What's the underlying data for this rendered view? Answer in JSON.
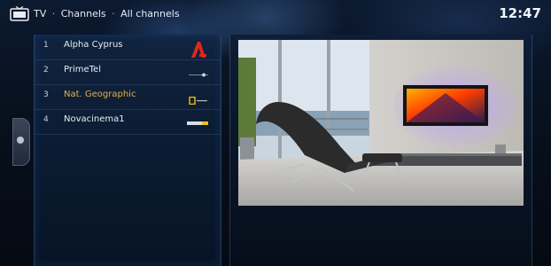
{
  "header": {
    "section": "TV",
    "separator": "·",
    "page": "Channels",
    "filter": "All channels",
    "time": "12:47"
  },
  "channels": [
    {
      "number": "1",
      "name": "Alpha Cyprus"
    },
    {
      "number": "2",
      "name": "PrimeTel"
    },
    {
      "number": "3",
      "name": "Nat. Geographic"
    },
    {
      "number": "4",
      "name": "Novacinema1"
    }
  ],
  "selected_channel_index": 2,
  "colors": {
    "accent_selected": "#e3b04a",
    "text": "#e8edf5",
    "panel": "#0e2240"
  },
  "icons": {
    "header": "tv-icon",
    "side_tab": "menu-handle-icon"
  }
}
